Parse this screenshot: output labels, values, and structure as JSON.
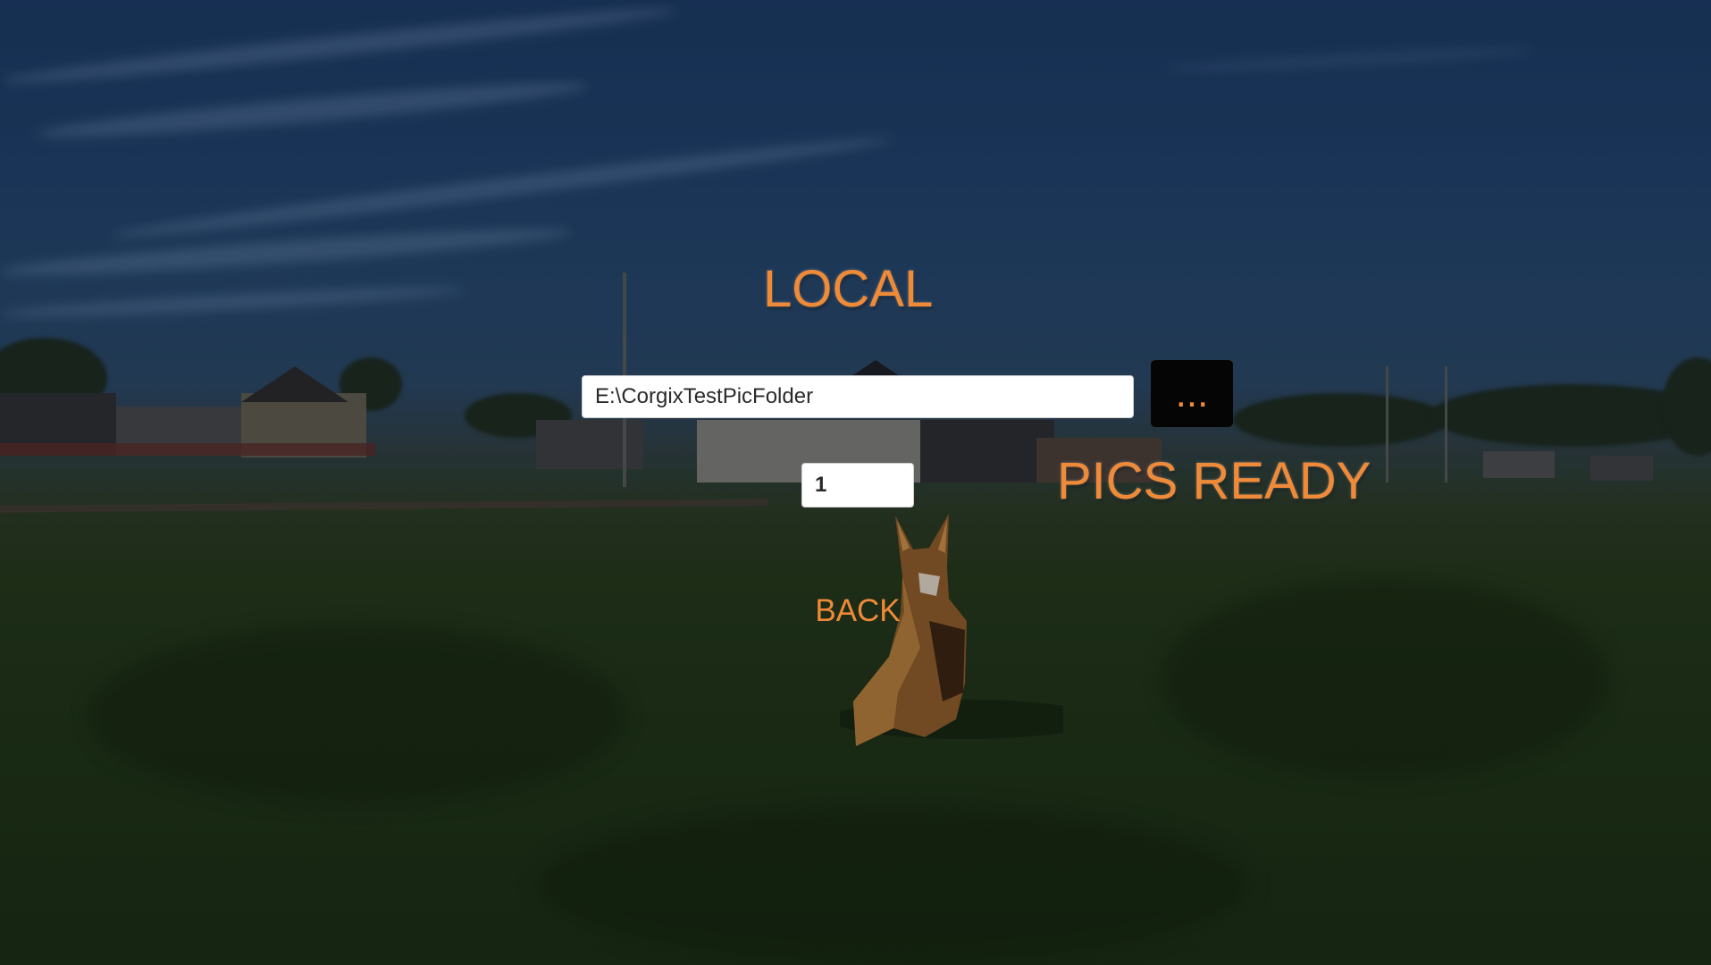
{
  "screen": {
    "title": "LOCAL",
    "status_label": "PICS READY"
  },
  "folder_picker": {
    "path_value": "E:\\CorgixTestPicFolder",
    "browse_label": "..."
  },
  "pics_count": {
    "value": "1"
  },
  "navigation": {
    "back_label": "BACK"
  },
  "theme": {
    "accent": "#ef8a38",
    "button_bg": "#050505",
    "input_bg": "#ffffff"
  },
  "background": {
    "icon": "corgi-in-field-photo"
  }
}
